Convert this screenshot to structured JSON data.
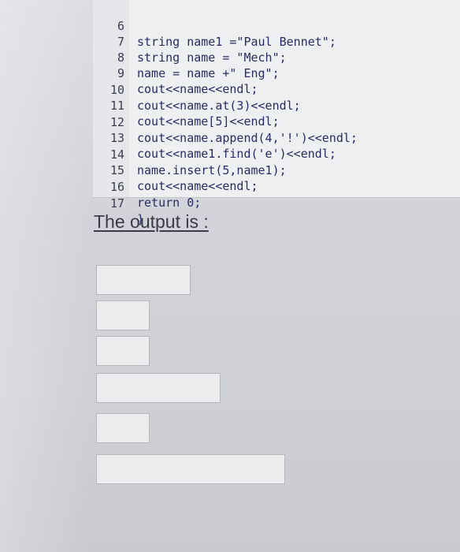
{
  "code_editor": {
    "lines": [
      {
        "num": "6",
        "text": "string name1 =\"Paul Bennet\";"
      },
      {
        "num": "7",
        "text": "string name = \"Mech\";"
      },
      {
        "num": "8",
        "text": "name = name +\" Eng\";"
      },
      {
        "num": "9",
        "text": "cout<<name<<endl;"
      },
      {
        "num": "10",
        "text": "cout<<name.at(3)<<endl;"
      },
      {
        "num": "11",
        "text": "cout<<name[5]<<endl;"
      },
      {
        "num": "12",
        "text": "cout<<name.append(4,'!')<<endl;"
      },
      {
        "num": "13",
        "text": "cout<<name1.find('e')<<endl;"
      },
      {
        "num": "14",
        "text": "name.insert(5,name1);"
      },
      {
        "num": "15",
        "text": "cout<<name<<endl;"
      },
      {
        "num": "16",
        "text": "return 0;"
      },
      {
        "num": "17",
        "text": "}"
      }
    ]
  },
  "output": {
    "heading": "The output is :",
    "answers": [
      "",
      "",
      "",
      "",
      "",
      ""
    ]
  }
}
